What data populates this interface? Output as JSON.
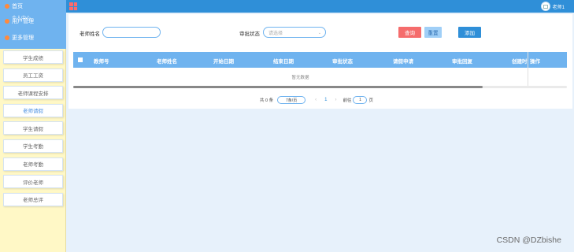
{
  "sidebar": {
    "home": "首页",
    "personal": "个人中心",
    "user_mgmt": "用户管理",
    "more_mgmt": "更多管理",
    "items": [
      {
        "label": "学生成绩"
      },
      {
        "label": "员工工资"
      },
      {
        "label": "老师课程安排"
      },
      {
        "label": "老师请假"
      },
      {
        "label": "学生请假"
      },
      {
        "label": "学生考勤"
      },
      {
        "label": "老师考勤"
      },
      {
        "label": "评价老师"
      },
      {
        "label": "老师总评"
      }
    ]
  },
  "header": {
    "user_name": "老师1"
  },
  "search": {
    "teacher_name_label": "老师姓名",
    "teacher_name_value": "",
    "status_label": "审批状态",
    "status_placeholder": "请选择"
  },
  "buttons": {
    "query": "查询",
    "reset": "重置",
    "add": "添加"
  },
  "table": {
    "columns": [
      "教师号",
      "老师姓名",
      "开始日期",
      "结束日期",
      "审批状态",
      "请假申请",
      "审批回复",
      "创建时",
      "操作"
    ],
    "empty_text": "暂无数据"
  },
  "pagination": {
    "total_text": "共 0 条",
    "page_size": "7条/页",
    "prev": "‹",
    "current": "1",
    "next": "›",
    "goto_prefix": "前往",
    "goto_value": "1",
    "goto_suffix": "页"
  },
  "watermark": "CSDN @DZbishe",
  "colors": {
    "accent": "#2f8fd8",
    "header_row": "#6fb3ef",
    "sidebar_bg": "#fff8c6",
    "query_btn": "#f56c6c"
  }
}
